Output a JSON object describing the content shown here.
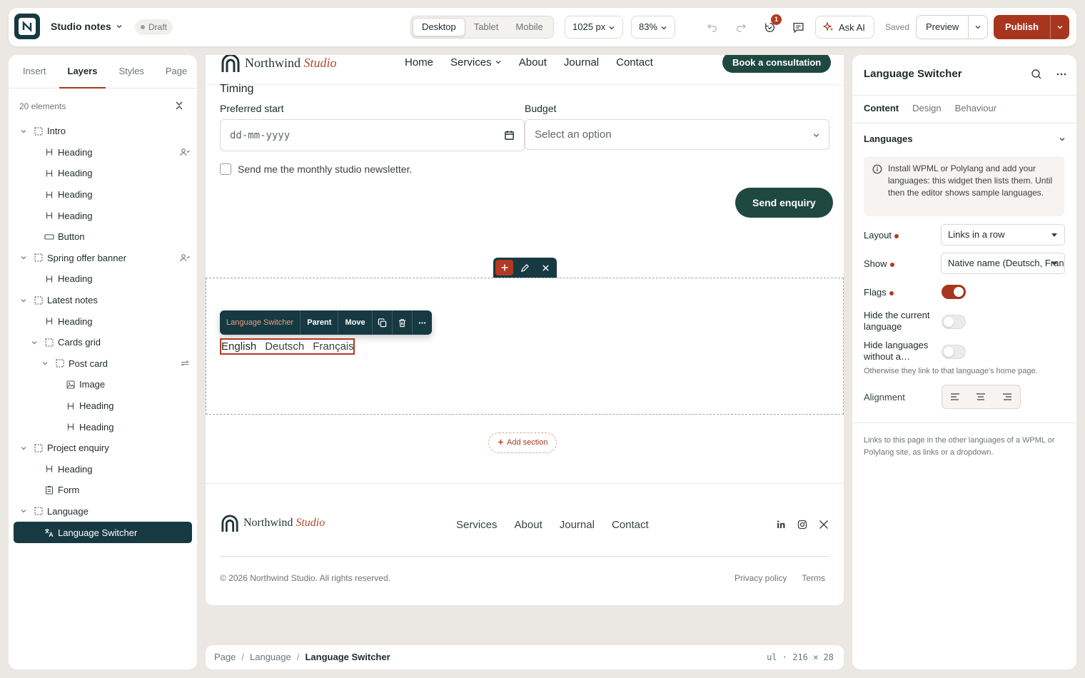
{
  "app": {
    "site_name": "Studio notes",
    "status": "Draft",
    "devices": [
      "Desktop",
      "Tablet",
      "Mobile"
    ],
    "active_device": "Desktop",
    "width": "1025 px",
    "zoom": "83%",
    "notification_count": "1",
    "ask_ai": "Ask AI",
    "saved": "Saved",
    "preview": "Preview",
    "publish": "Publish",
    "icons": [
      "undo-icon",
      "redo-icon",
      "history-icon",
      "comments-icon",
      "sparkle-icon",
      "chevron-down-icon"
    ]
  },
  "left_panel": {
    "tabs": [
      "Insert",
      "Layers",
      "Styles",
      "Page"
    ],
    "active_tab": "Layers",
    "count": "20 elements",
    "layers": [
      {
        "label": "Intro",
        "icon": "container-icon",
        "depth": 0,
        "expandable": true
      },
      {
        "label": "Heading",
        "icon": "heading-icon",
        "depth": 1,
        "badge": "user-icon"
      },
      {
        "label": "Heading",
        "icon": "heading-icon",
        "depth": 1
      },
      {
        "label": "Heading",
        "icon": "heading-icon",
        "depth": 1
      },
      {
        "label": "Heading",
        "icon": "heading-icon",
        "depth": 1
      },
      {
        "label": "Button",
        "icon": "button-icon",
        "depth": 1
      },
      {
        "label": "Spring offer banner",
        "icon": "container-icon",
        "depth": 0,
        "expandable": true,
        "badge": "user-icon"
      },
      {
        "label": "Heading",
        "icon": "heading-icon",
        "depth": 1
      },
      {
        "label": "Latest notes",
        "icon": "container-icon",
        "depth": 0,
        "expandable": true
      },
      {
        "label": "Heading",
        "icon": "heading-icon",
        "depth": 1
      },
      {
        "label": "Cards grid",
        "icon": "container-icon",
        "depth": 1,
        "expandable": true
      },
      {
        "label": "Post card",
        "icon": "container-icon",
        "depth": 2,
        "expandable": true,
        "badge": "sync-icon"
      },
      {
        "label": "Image",
        "icon": "image-icon",
        "depth": 3
      },
      {
        "label": "Heading",
        "icon": "heading-icon",
        "depth": 3
      },
      {
        "label": "Heading",
        "icon": "heading-icon",
        "depth": 3
      },
      {
        "label": "Project enquiry",
        "icon": "container-icon",
        "depth": 0,
        "expandable": true
      },
      {
        "label": "Heading",
        "icon": "heading-icon",
        "depth": 1
      },
      {
        "label": "Form",
        "icon": "form-icon",
        "depth": 1
      },
      {
        "label": "Language",
        "icon": "container-icon",
        "depth": 0,
        "expandable": true
      },
      {
        "label": "Language Switcher",
        "icon": "translate-icon",
        "depth": 1,
        "selected": true
      }
    ]
  },
  "canvas": {
    "brand": "Northwind",
    "brand_accent": "Studio",
    "nav": [
      "Home",
      "Services",
      "About",
      "Journal",
      "Contact"
    ],
    "cta": "Book a consultation",
    "section_title": "Timing",
    "preferred_start_label": "Preferred start",
    "preferred_start_value": "dd-mm-yyyy",
    "budget_label": "Budget",
    "budget_value": "Select an option",
    "newsletter": "Send me the monthly studio newsletter.",
    "send": "Send enquiry",
    "widget_toolbar": {
      "name": "Language Switcher",
      "parent": "Parent",
      "move": "Move"
    },
    "languages": [
      "English",
      "Deutsch",
      "Français"
    ],
    "add_section": "Add section",
    "footer_nav": [
      "Services",
      "About",
      "Journal",
      "Contact"
    ],
    "copyright": "© 2026 Northwind Studio. All rights reserved.",
    "legal": [
      "Privacy policy",
      "Terms"
    ],
    "social_icons": [
      "linkedin-icon",
      "instagram-icon",
      "x-icon"
    ]
  },
  "breadcrumb": {
    "items": [
      "Page",
      "Language",
      "Language Switcher"
    ],
    "tag": "ul",
    "size": "216 × 28"
  },
  "right_panel": {
    "title": "Language Switcher",
    "tabs": [
      "Content",
      "Design",
      "Behaviour"
    ],
    "active_tab": "Content",
    "group": "Languages",
    "info": "Install WPML or Polylang and add your languages: this widget then lists them. Until then the editor shows sample languages.",
    "layout_label": "Layout",
    "layout_value": "Links in a row",
    "show_label": "Show",
    "show_value": "Native name (Deutsch, Français)",
    "flags_label": "Flags",
    "flags_on": true,
    "hide_current_label": "Hide the current language",
    "hide_current_on": false,
    "hide_missing_label": "Hide languages without a…",
    "hide_missing_on": false,
    "hint": "Otherwise they link to that language's home page.",
    "alignment_label": "Alignment",
    "description": "Links to this page in the other languages of a WPML or Polylang site, as links or a dropdown."
  },
  "colors": {
    "accent": "#a8361f",
    "dark": "#173a42",
    "button": "#1f4840"
  }
}
